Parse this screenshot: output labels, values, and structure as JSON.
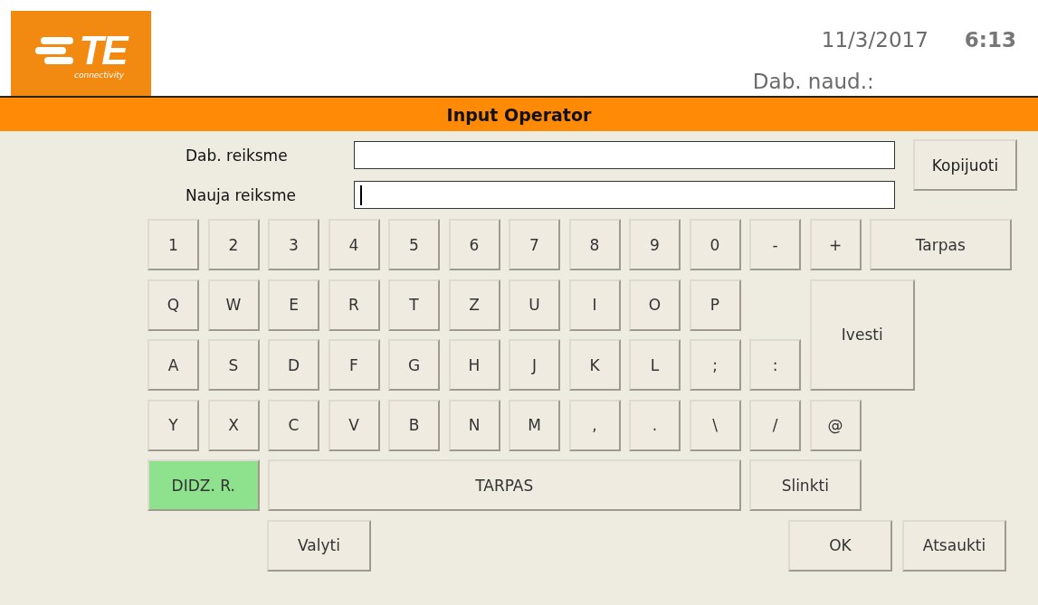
{
  "logo": {
    "mark": "TE",
    "tagline": "connectivity"
  },
  "header": {
    "date": "11/3/2017",
    "time": "6:13",
    "current_user_label": "Dab. naud.:"
  },
  "title": "Input Operator",
  "fields": [
    {
      "label": "Dab. reiksme",
      "focused": false
    },
    {
      "label": "Nauja reiksme",
      "focused": true
    }
  ],
  "copy_button": "Kopijuoti",
  "keys": [
    {
      "label": "1",
      "active": false
    },
    {
      "label": "2",
      "active": false
    },
    {
      "label": "3",
      "active": false
    },
    {
      "label": "4",
      "active": false
    },
    {
      "label": "5",
      "active": false
    },
    {
      "label": "6",
      "active": false
    },
    {
      "label": "7",
      "active": false
    },
    {
      "label": "8",
      "active": false
    },
    {
      "label": "9",
      "active": false
    },
    {
      "label": "0",
      "active": false
    },
    {
      "label": "-",
      "active": false
    },
    {
      "label": "+",
      "active": false
    },
    {
      "label": "Tarpas",
      "active": false
    },
    {
      "label": "Q",
      "active": false
    },
    {
      "label": "W",
      "active": false
    },
    {
      "label": "E",
      "active": false
    },
    {
      "label": "R",
      "active": false
    },
    {
      "label": "T",
      "active": false
    },
    {
      "label": "Z",
      "active": false
    },
    {
      "label": "U",
      "active": false
    },
    {
      "label": "I",
      "active": false
    },
    {
      "label": "O",
      "active": false
    },
    {
      "label": "P",
      "active": false
    },
    {
      "label": "Ivesti",
      "active": false
    },
    {
      "label": "A",
      "active": false
    },
    {
      "label": "S",
      "active": false
    },
    {
      "label": "D",
      "active": false
    },
    {
      "label": "F",
      "active": false
    },
    {
      "label": "G",
      "active": false
    },
    {
      "label": "H",
      "active": false
    },
    {
      "label": "J",
      "active": false
    },
    {
      "label": "K",
      "active": false
    },
    {
      "label": "L",
      "active": false
    },
    {
      "label": ";",
      "active": false
    },
    {
      "label": ":",
      "active": false
    },
    {
      "label": "Y",
      "active": false
    },
    {
      "label": "X",
      "active": false
    },
    {
      "label": "C",
      "active": false
    },
    {
      "label": "V",
      "active": false
    },
    {
      "label": "B",
      "active": false
    },
    {
      "label": "N",
      "active": false
    },
    {
      "label": "M",
      "active": false
    },
    {
      "label": ",",
      "active": false
    },
    {
      "label": ".",
      "active": false
    },
    {
      "label": "\\",
      "active": false
    },
    {
      "label": "/",
      "active": false
    },
    {
      "label": "@",
      "active": false
    },
    {
      "label": "DIDZ. R.",
      "active": true
    },
    {
      "label": "TARPAS",
      "active": false
    },
    {
      "label": "Slinkti",
      "active": false
    }
  ],
  "bottom_buttons": [
    "Valyti",
    "OK",
    "Atsaukti"
  ]
}
